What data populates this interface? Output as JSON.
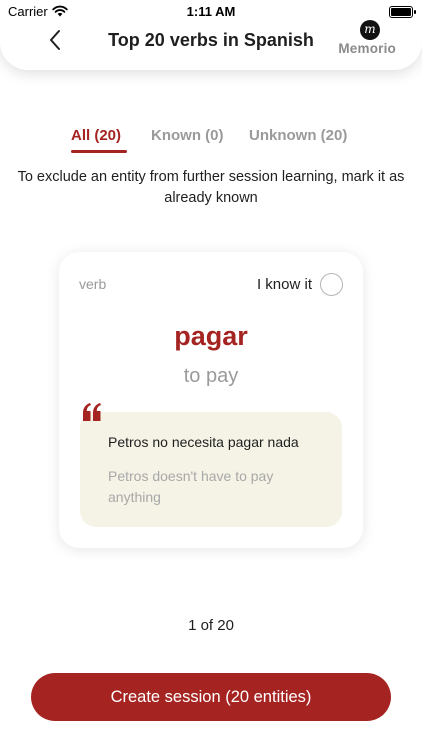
{
  "status_bar": {
    "carrier": "Carrier",
    "time": "1:11 AM"
  },
  "header": {
    "title": "Top 20 verbs in Spanish",
    "brand": "Memorio",
    "brand_mark": "m"
  },
  "tabs": [
    {
      "label": "All (20)",
      "active": true
    },
    {
      "label": "Known (0)",
      "active": false
    },
    {
      "label": "Unknown (20)",
      "active": false
    }
  ],
  "hint": "To exclude an entity from further session learning, mark it as already known",
  "card": {
    "part_of_speech": "verb",
    "know_label": "I know it",
    "word": "pagar",
    "translation": "to pay",
    "example_source": "Petros no necesita pagar nada",
    "example_translation": "Petros doesn't have to pay anything"
  },
  "pager": "1 of 20",
  "cta_label": "Create session (20 entities)",
  "colors": {
    "accent": "#a52421",
    "example_bg": "#f5f2e6",
    "muted": "#9a9a9a"
  },
  "icons": {
    "back": "chevron-left-icon",
    "quote": "quote-icon",
    "wifi": "wifi-icon",
    "battery": "battery-icon"
  }
}
